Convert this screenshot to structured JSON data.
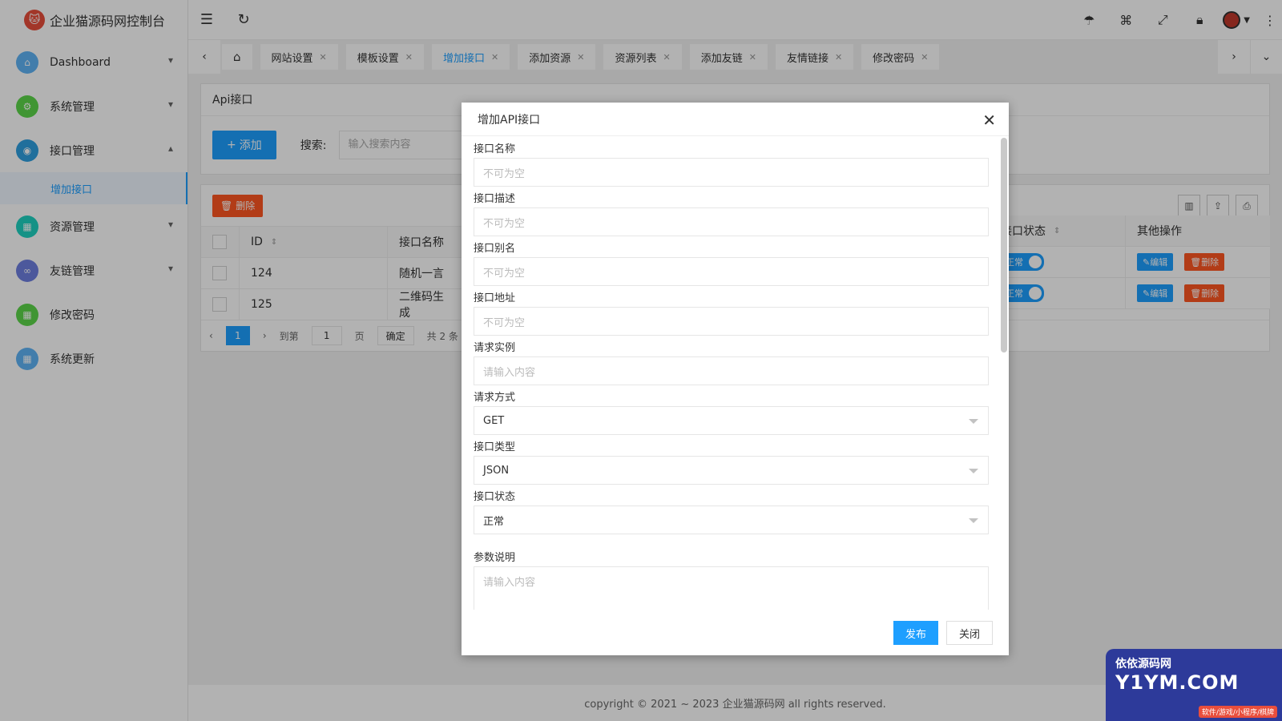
{
  "app": {
    "title": "企业猫源码网控制台"
  },
  "sidebar": {
    "items": [
      {
        "label": "Dashboard",
        "color": "#5fb3f5",
        "chevron": "⌄"
      },
      {
        "label": "系统管理",
        "color": "#5cd64a",
        "chevron": "⌄"
      },
      {
        "label": "接口管理",
        "color": "#2f9fe0",
        "chevron": "⌃"
      },
      {
        "label": "资源管理",
        "color": "#1fd1c1",
        "chevron": "⌄"
      },
      {
        "label": "友链管理",
        "color": "#6d7fe0",
        "chevron": "⌄"
      },
      {
        "label": "修改密码",
        "color": "#5cd64a",
        "chevron": ""
      },
      {
        "label": "系统更新",
        "color": "#5fb3f5",
        "chevron": ""
      }
    ],
    "sub_item": "增加接口"
  },
  "topbar": {
    "icons": [
      "menu-fold-icon",
      "refresh-icon",
      "feedback-icon",
      "tag-icon",
      "fullscreen-icon",
      "lock-icon",
      "avatar",
      "more-icon"
    ]
  },
  "tabs": [
    {
      "label": "网站设置",
      "active": false
    },
    {
      "label": "模板设置",
      "active": false
    },
    {
      "label": "增加接口",
      "active": true
    },
    {
      "label": "添加资源",
      "active": false
    },
    {
      "label": "资源列表",
      "active": false
    },
    {
      "label": "添加友链",
      "active": false
    },
    {
      "label": "友情链接",
      "active": false
    },
    {
      "label": "修改密码",
      "active": false
    }
  ],
  "main": {
    "panel_title": "Api接口",
    "add_button": "添加",
    "search_label": "搜索:",
    "search_placeholder": "输入搜索内容",
    "delete_button": "删除",
    "columns": [
      "ID",
      "接口名称",
      "接口状态",
      "其他操作"
    ],
    "rows": [
      {
        "id": "124",
        "name": "随机一言",
        "status": "正常",
        "edit": "编辑",
        "del": "删除"
      },
      {
        "id": "125",
        "name": "二维码生成",
        "status": "正常",
        "edit": "编辑",
        "del": "删除"
      }
    ],
    "pager": {
      "current": "1",
      "goto": "到第",
      "page_input": "1",
      "page_unit": "页",
      "confirm": "确定",
      "total": "共 2 条"
    }
  },
  "modal": {
    "title": "增加API接口",
    "fields": [
      {
        "label": "接口名称",
        "placeholder": "不可为空"
      },
      {
        "label": "接口描述",
        "placeholder": "不可为空"
      },
      {
        "label": "接口别名",
        "placeholder": "不可为空"
      },
      {
        "label": "接口地址",
        "placeholder": "不可为空"
      },
      {
        "label": "请求实例",
        "placeholder": "请输入内容"
      }
    ],
    "selects": [
      {
        "label": "请求方式",
        "value": "GET"
      },
      {
        "label": "接口类型",
        "value": "JSON"
      },
      {
        "label": "接口状态",
        "value": "正常"
      }
    ],
    "textarea": {
      "label": "参数说明",
      "placeholder": "请输入内容"
    },
    "submit": "发布",
    "close": "关闭"
  },
  "footer": {
    "text": "copyright © 2021 ~ 2023 企业猫源码网 all rights reserved."
  },
  "watermark": {
    "line1": "依依源码网",
    "line2": "Y1YM.COM",
    "line3": "软件/游戏/小程序/棋牌"
  }
}
